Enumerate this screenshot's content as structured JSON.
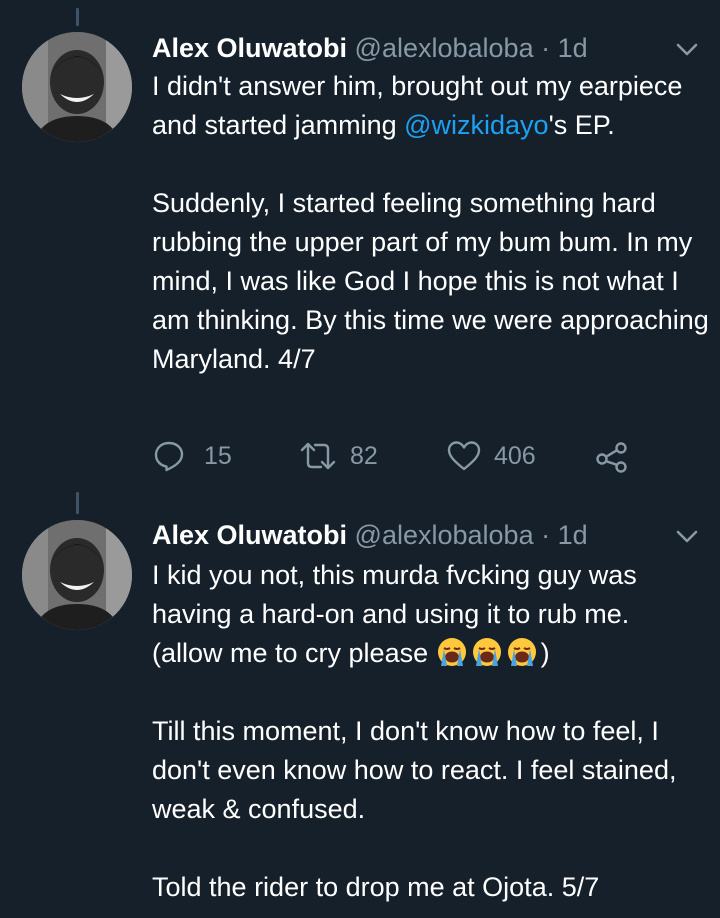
{
  "colors": {
    "background": "#15202b",
    "text": "#ffffff",
    "secondary": "#8899a6",
    "link": "#1da1f2",
    "thread_line": "#3d5466"
  },
  "tweets": [
    {
      "author": "Alex Oluwatobi",
      "handle": "@alexlobaloba",
      "separator": "·",
      "time": "1d",
      "paragraphs": [
        {
          "before": "I didn't answer him, brought out my earpiece and started jamming ",
          "mention": "@wizkidayo",
          "after": "'s EP."
        },
        {
          "text": "Suddenly, I started feeling something hard rubbing the upper part of my bum bum. In my mind, I was like God I hope this is not what I am thinking. By this time we were approaching Maryland. 4/7"
        }
      ],
      "actions": {
        "replies": "15",
        "retweets": "82",
        "likes": "406"
      },
      "icons": [
        "reply-icon",
        "retweet-icon",
        "like-icon",
        "share-icon"
      ]
    },
    {
      "author": "Alex Oluwatobi",
      "handle": "@alexlobaloba",
      "separator": "·",
      "time": "1d",
      "paragraphs": [
        {
          "text": "I kid you not, this murda fvcking guy was having a hard-on and using it to rub me.",
          "line2_before": "(allow me to cry please ",
          "emojis": [
            "loudly-crying-face",
            "loudly-crying-face",
            "loudly-crying-face"
          ],
          "line2_after": ")"
        },
        {
          "text": "Till this moment, I don't know how to feel, I don't even know how to react. I feel stained, weak & confused."
        },
        {
          "text": "Told the rider to drop me at Ojota. 5/7"
        }
      ]
    }
  ]
}
